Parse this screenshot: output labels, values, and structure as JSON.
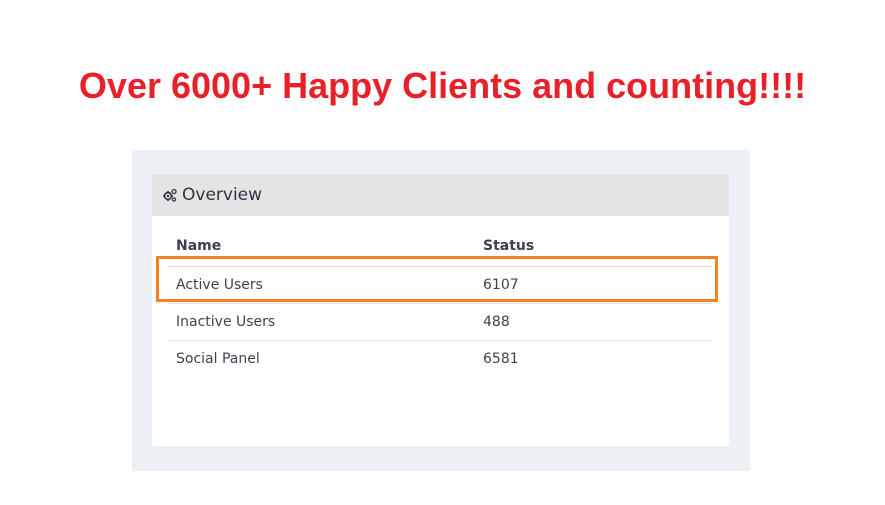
{
  "headline": "Over 6000+ Happy Clients and counting!!!!",
  "overview": {
    "title": "Overview",
    "icon": "gears-icon",
    "columns": {
      "name": "Name",
      "status": "Status"
    },
    "rows": [
      {
        "name": "Active Users",
        "status": "6107"
      },
      {
        "name": "Inactive Users",
        "status": "488"
      },
      {
        "name": "Social Panel",
        "status": "6581"
      }
    ]
  },
  "colors": {
    "headline": "#e8202a",
    "highlight": "#f58220",
    "panel_background": "#edf0f5",
    "card_header": "#e4e4e4"
  }
}
